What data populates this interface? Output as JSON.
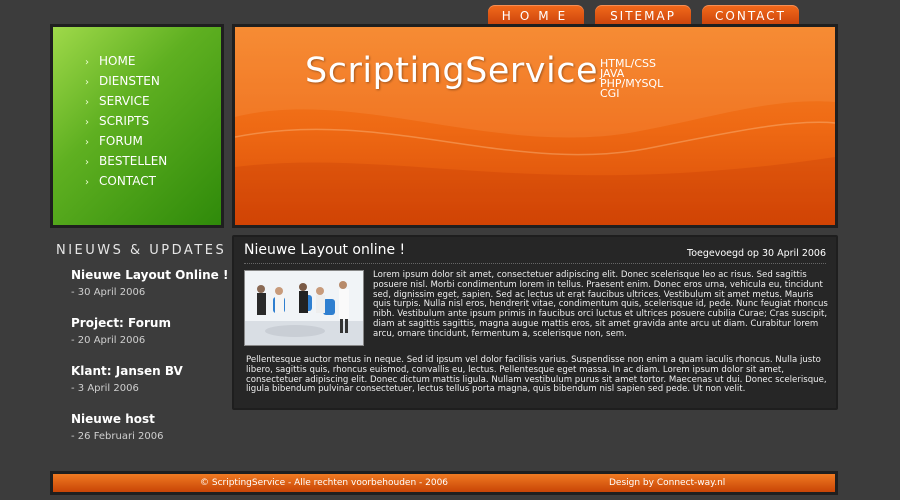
{
  "top_tabs": {
    "home": "HOME",
    "sitemap": "SITEMAP",
    "contact": "CONTACT"
  },
  "nav": {
    "items": [
      {
        "label": "HOME"
      },
      {
        "label": "DIENSTEN"
      },
      {
        "label": "SERVICE"
      },
      {
        "label": "SCRIPTS"
      },
      {
        "label": "FORUM"
      },
      {
        "label": "BESTELLEN"
      },
      {
        "label": "CONTACT"
      }
    ],
    "bullet_icon": "chevron-right-icon"
  },
  "banner": {
    "title": "ScriptingService",
    "skills": [
      "HTML/CSS",
      "JAVA",
      "PHP/MYSQL",
      "CGI"
    ]
  },
  "news": {
    "heading": "NIEUWS & UPDATES",
    "items": [
      {
        "title": "Nieuwe Layout Online !",
        "date": "- 30 April 2006"
      },
      {
        "title": "Project: Forum",
        "date": "- 20 April 2006"
      },
      {
        "title": "Klant: Jansen BV",
        "date": "- 3 April 2006"
      },
      {
        "title": "Nieuwe host",
        "date": "- 26 Februari 2006"
      }
    ]
  },
  "article": {
    "title": "Nieuwe Layout online !",
    "date": "Toegevoegd op 30 April 2006",
    "paragraph1": "Lorem ipsum dolor sit amet, consectetuer adipiscing elit. Donec scelerisque leo ac risus. Sed sagittis posuere nisl. Morbi condimentum lorem in tellus. Praesent enim. Donec eros urna, vehicula eu, tincidunt sed, dignissim eget, sapien. Sed ac lectus ut erat faucibus ultrices. Vestibulum sit amet metus. Mauris quis turpis. Nulla nisl eros, hendrerit vitae, condimentum quis, scelerisque id, pede. Nunc feugiat rhoncus nibh. Vestibulum ante ipsum primis in faucibus orci luctus et ultrices posuere cubilia Curae; Cras suscipit, diam at sagittis sagittis, magna augue mattis eros, sit amet gravida ante arcu ut diam. Curabitur lorem arcu, ornare tincidunt, fermentum a, scelerisque non, sem.",
    "paragraph2": "Pellentesque auctor metus in neque. Sed id ipsum vel dolor facilisis varius. Suspendisse non enim a quam iaculis rhoncus. Nulla justo libero, sagittis quis, rhoncus euismod, convallis eu, lectus. Pellentesque eget massa. In ac diam. Lorem ipsum dolor sit amet, consectetuer adipiscing elit. Donec dictum mattis ligula. Nullam vestibulum purus sit amet tortor. Maecenas ut dui. Donec scelerisque, ligula bibendum pulvinar consectetuer, lectus tellus porta magna, quis bibendum nisl sapien sed pede. Ut non velit."
  },
  "footer": {
    "copyright": "© ScriptingService - Alle rechten voorbehouden - 2006",
    "design": "Design by Connect-way.nl"
  },
  "colors": {
    "background": "#3c3c3c",
    "orange": "#ef6a14",
    "green": "#5fb021",
    "panel": "#262626"
  }
}
